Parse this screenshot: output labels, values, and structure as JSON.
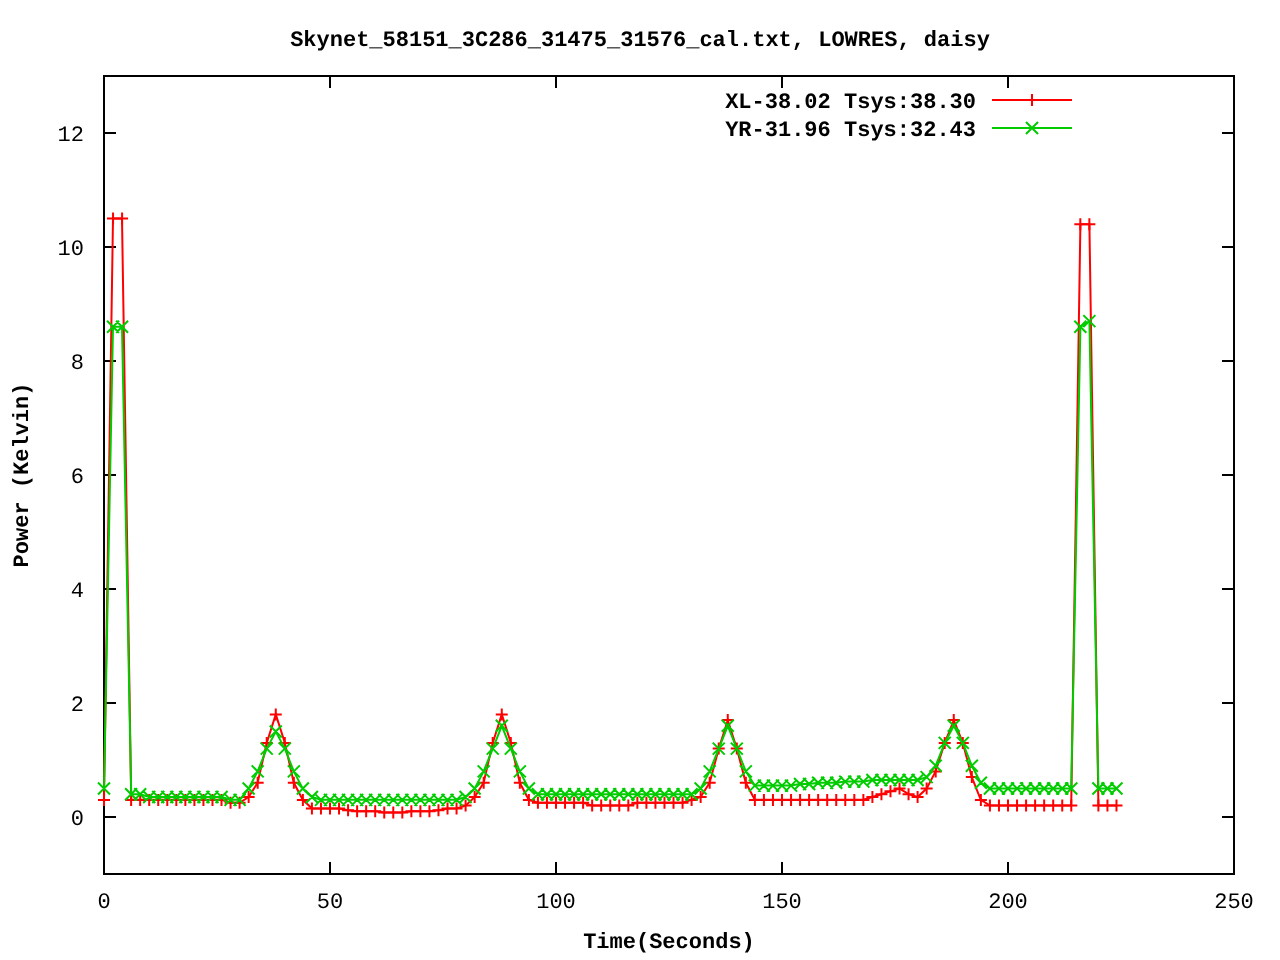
{
  "chart_data": {
    "type": "line",
    "title": "Skynet_58151_3C286_31475_31576_cal.txt, LOWRES, daisy",
    "xlabel": "Time(Seconds)",
    "ylabel": "Power (Kelvin)",
    "x": [
      0,
      2,
      4,
      6,
      8,
      10,
      12,
      14,
      16,
      18,
      20,
      22,
      24,
      26,
      28,
      30,
      32,
      34,
      36,
      38,
      40,
      42,
      44,
      46,
      48,
      50,
      52,
      54,
      56,
      58,
      60,
      62,
      64,
      66,
      68,
      70,
      72,
      74,
      76,
      78,
      80,
      82,
      84,
      86,
      88,
      90,
      92,
      94,
      96,
      98,
      100,
      102,
      104,
      106,
      108,
      110,
      112,
      114,
      116,
      118,
      120,
      122,
      124,
      126,
      128,
      130,
      132,
      134,
      136,
      138,
      140,
      142,
      144,
      146,
      148,
      150,
      152,
      154,
      156,
      158,
      160,
      162,
      164,
      166,
      168,
      170,
      172,
      174,
      176,
      178,
      180,
      182,
      184,
      186,
      188,
      190,
      192,
      194,
      196,
      198,
      200,
      202,
      204,
      206,
      208,
      210,
      212,
      214,
      216,
      218,
      220,
      222,
      224
    ],
    "series": [
      {
        "name": "XL-38.02 Tsys:38.30",
        "color": "#ff0000",
        "marker": "plus",
        "values": [
          0.3,
          10.5,
          10.5,
          0.3,
          0.3,
          0.3,
          0.3,
          0.3,
          0.3,
          0.3,
          0.3,
          0.3,
          0.3,
          0.3,
          0.25,
          0.25,
          0.35,
          0.6,
          1.3,
          1.8,
          1.3,
          0.6,
          0.3,
          0.15,
          0.15,
          0.15,
          0.15,
          0.12,
          0.1,
          0.1,
          0.1,
          0.08,
          0.08,
          0.08,
          0.1,
          0.1,
          0.1,
          0.12,
          0.15,
          0.15,
          0.2,
          0.35,
          0.6,
          1.3,
          1.8,
          1.3,
          0.6,
          0.3,
          0.25,
          0.25,
          0.25,
          0.25,
          0.25,
          0.25,
          0.2,
          0.2,
          0.2,
          0.2,
          0.2,
          0.25,
          0.25,
          0.25,
          0.25,
          0.25,
          0.25,
          0.3,
          0.35,
          0.6,
          1.2,
          1.7,
          1.2,
          0.6,
          0.3,
          0.3,
          0.3,
          0.3,
          0.3,
          0.3,
          0.3,
          0.3,
          0.3,
          0.3,
          0.3,
          0.3,
          0.3,
          0.35,
          0.4,
          0.45,
          0.5,
          0.4,
          0.35,
          0.5,
          0.8,
          1.3,
          1.7,
          1.3,
          0.7,
          0.3,
          0.2,
          0.2,
          0.2,
          0.2,
          0.2,
          0.2,
          0.2,
          0.2,
          0.2,
          0.2,
          10.4,
          10.4,
          0.2,
          0.2,
          0.2
        ]
      },
      {
        "name": "YR-31.96 Tsys:32.43",
        "color": "#00cc00",
        "marker": "cross",
        "values": [
          0.5,
          8.6,
          8.6,
          0.4,
          0.4,
          0.35,
          0.35,
          0.35,
          0.35,
          0.35,
          0.35,
          0.35,
          0.35,
          0.35,
          0.3,
          0.3,
          0.5,
          0.8,
          1.2,
          1.5,
          1.2,
          0.8,
          0.5,
          0.35,
          0.3,
          0.3,
          0.3,
          0.3,
          0.3,
          0.3,
          0.3,
          0.3,
          0.3,
          0.3,
          0.3,
          0.3,
          0.3,
          0.3,
          0.3,
          0.3,
          0.35,
          0.5,
          0.8,
          1.2,
          1.6,
          1.2,
          0.8,
          0.5,
          0.4,
          0.4,
          0.4,
          0.4,
          0.4,
          0.4,
          0.4,
          0.4,
          0.4,
          0.4,
          0.4,
          0.4,
          0.4,
          0.4,
          0.4,
          0.4,
          0.4,
          0.4,
          0.5,
          0.8,
          1.2,
          1.6,
          1.2,
          0.8,
          0.55,
          0.55,
          0.55,
          0.55,
          0.55,
          0.58,
          0.58,
          0.6,
          0.6,
          0.6,
          0.62,
          0.62,
          0.62,
          0.65,
          0.65,
          0.65,
          0.65,
          0.65,
          0.65,
          0.7,
          0.9,
          1.3,
          1.6,
          1.3,
          0.9,
          0.6,
          0.5,
          0.5,
          0.5,
          0.5,
          0.5,
          0.5,
          0.5,
          0.5,
          0.5,
          0.5,
          8.6,
          8.7,
          0.5,
          0.5,
          0.5
        ]
      }
    ],
    "legend": "top-right",
    "xlim": [
      0,
      250
    ],
    "ylim": [
      -1,
      13
    ],
    "xticks": [
      0,
      50,
      100,
      150,
      200,
      250
    ],
    "yticks": [
      0,
      2,
      4,
      6,
      8,
      10,
      12
    ]
  }
}
